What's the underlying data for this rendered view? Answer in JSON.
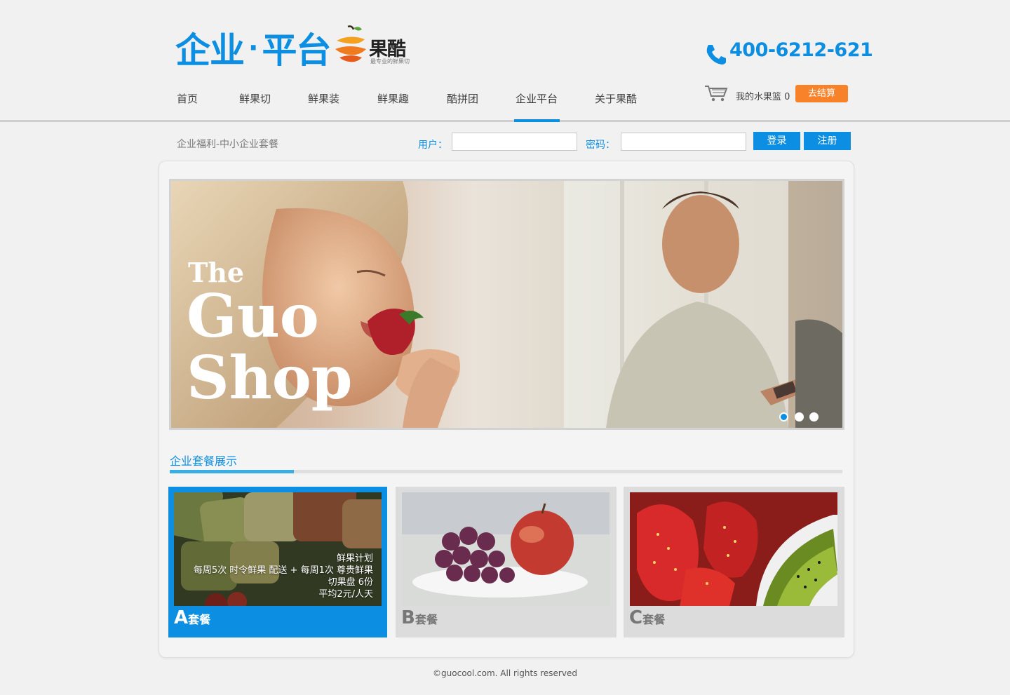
{
  "header": {
    "platform_title_left": "企业",
    "platform_sep": "·",
    "platform_title_right": "平台",
    "brand_name": "果酷",
    "brand_slogan": "最专业的鲜果切",
    "phone": "400-6212-621"
  },
  "nav": {
    "items": [
      {
        "label": "首页"
      },
      {
        "label": "鲜果切"
      },
      {
        "label": "鲜果装"
      },
      {
        "label": "鲜果趣"
      },
      {
        "label": "酷拼团"
      },
      {
        "label": "企业平台"
      },
      {
        "label": "关于果酷"
      }
    ],
    "active_index": 5
  },
  "cart": {
    "label": "我的水果篮",
    "count": "0",
    "checkout_label": "去结算"
  },
  "login_bar": {
    "breadcrumb": "企业福利-中小企业套餐",
    "user_label": "用户：",
    "password_label": "密码：",
    "user_value": "",
    "password_value": "",
    "login_label": "登录",
    "register_label": "注册"
  },
  "banner": {
    "line1": "The",
    "line2": "Guo",
    "line3": "Shop",
    "slide_count": 3,
    "active_slide": 0
  },
  "packages": {
    "section_title": "企业套餐展示",
    "cards": [
      {
        "letter": "A",
        "word": "套餐",
        "active": true,
        "caption": [
          "鲜果计划",
          "每周5次 时令鲜果 配送 + 每周1次 尊贵鲜果",
          "切果盘 6份",
          "平均2元/人天"
        ]
      },
      {
        "letter": "B",
        "word": "套餐",
        "active": false
      },
      {
        "letter": "C",
        "word": "套餐",
        "active": false
      }
    ]
  },
  "footer": {
    "copyright": "©guocool.com. All rights reserved"
  },
  "colors": {
    "accent": "#0c8fe2",
    "orange": "#f8822a",
    "background": "#f1f1f1"
  }
}
